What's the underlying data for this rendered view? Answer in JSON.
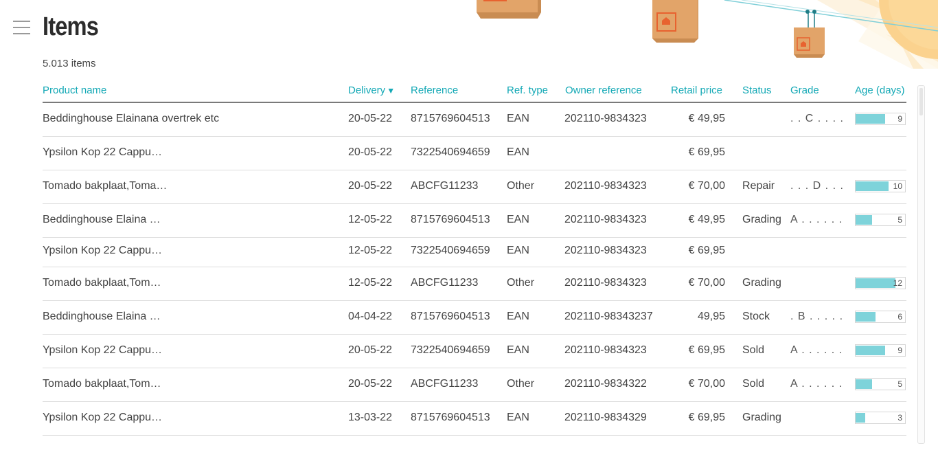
{
  "title": "Items",
  "item_count": "5.013 items",
  "columns": {
    "product": "Product name",
    "delivery": "Delivery",
    "reference": "Reference",
    "ref_type": "Ref. type",
    "owner_reference": "Owner reference",
    "retail_price": "Retail price",
    "status": "Status",
    "grade": "Grade",
    "age": "Age (days)"
  },
  "sort_indicator": "▼",
  "age_max": 15,
  "colors": {
    "accent": "#12a8b5",
    "bar_fill": "#7ed3da",
    "box": "#e2a469",
    "sun": "#fbd28e"
  },
  "rows": [
    {
      "product": "Beddinghouse Elainana overtrek etc",
      "delivery": "20-05-22",
      "reference": "8715769604513",
      "ref_type": "EAN",
      "owner_reference": "202110-9834323",
      "price": "€ 49,95",
      "status": "",
      "grade": ". . C . . . .",
      "age": "9"
    },
    {
      "product": "Ypsilon Kop 22 Cappu…",
      "delivery": "20-05-22",
      "reference": "7322540694659",
      "ref_type": "EAN",
      "owner_reference": "",
      "price": "€ 69,95",
      "status": "",
      "grade": "",
      "age": ""
    },
    {
      "product": "Tomado bakplaat,Toma…",
      "delivery": "20-05-22",
      "reference": "ABCFG11233",
      "ref_type": "Other",
      "owner_reference": "202110-9834323",
      "price": "€ 70,00",
      "status": "Repair",
      "grade": ". . . D . . .",
      "age": "10"
    },
    {
      "product": "Beddinghouse Elaina …",
      "delivery": "12-05-22",
      "reference": "8715769604513",
      "ref_type": "EAN",
      "owner_reference": "202110-9834323",
      "price": "€ 49,95",
      "status": "Grading",
      "grade": "A . . . . . .",
      "age": "5"
    },
    {
      "product": "Ypsilon Kop 22 Cappu…",
      "delivery": "12-05-22",
      "reference": "7322540694659",
      "ref_type": "EAN",
      "owner_reference": "202110-9834323",
      "price": "€ 69,95",
      "status": "",
      "grade": "",
      "age": ""
    },
    {
      "product": "Tomado bakplaat,Tom…",
      "delivery": "12-05-22",
      "reference": "ABCFG11233",
      "ref_type": "Other",
      "owner_reference": "202110-9834323",
      "price": "€ 70,00",
      "status": "Grading",
      "grade": "",
      "age": "12"
    },
    {
      "product": "Beddinghouse Elaina …",
      "delivery": "04-04-22",
      "reference": "8715769604513",
      "ref_type": "EAN",
      "owner_reference": "202110-98343237",
      "price": "49,95",
      "status": "Stock",
      "grade": ". B . . . . .",
      "age": "6"
    },
    {
      "product": "Ypsilon Kop 22 Cappu…",
      "delivery": "20-05-22",
      "reference": "7322540694659",
      "ref_type": "EAN",
      "owner_reference": "202110-9834323",
      "price": "€ 69,95",
      "status": "Sold",
      "grade": "A . . . . . .",
      "age": "9"
    },
    {
      "product": "Tomado bakplaat,Tom…",
      "delivery": "20-05-22",
      "reference": "ABCFG11233",
      "ref_type": "Other",
      "owner_reference": "202110-9834322",
      "price": "€ 70,00",
      "status": "Sold",
      "grade": "A . . . . . .",
      "age": "5"
    },
    {
      "product": "Ypsilon Kop 22 Cappu…",
      "delivery": "13-03-22",
      "reference": "8715769604513",
      "ref_type": "EAN",
      "owner_reference": "202110-9834329",
      "price": "€ 69,95",
      "status": "Grading",
      "grade": "",
      "age": "3"
    }
  ]
}
